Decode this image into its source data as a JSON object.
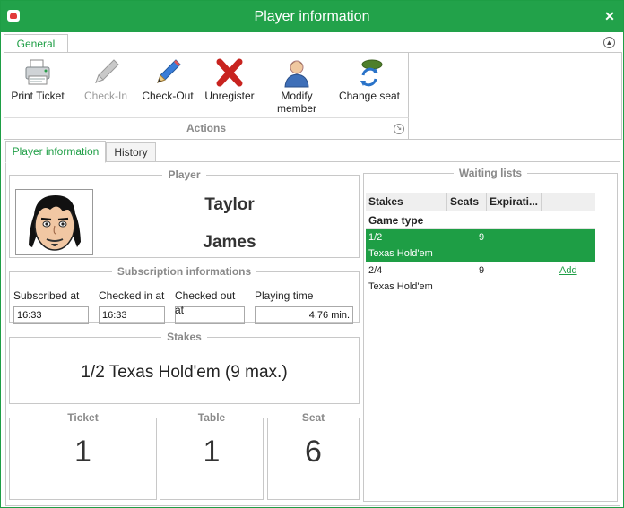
{
  "window": {
    "title": "Player information"
  },
  "ribbon": {
    "tab": "General",
    "buttons": [
      {
        "label": "Print Ticket",
        "icon": "printer-icon",
        "enabled": true
      },
      {
        "label": "Check-In",
        "icon": "pencil-icon",
        "enabled": false
      },
      {
        "label": "Check-Out",
        "icon": "pencil-icon",
        "enabled": true
      },
      {
        "label": "Unregister",
        "icon": "red-x-icon",
        "enabled": true
      },
      {
        "label": "Modify member",
        "icon": "user-icon",
        "enabled": true
      },
      {
        "label": "Change seat",
        "icon": "swap-seat-icon",
        "enabled": true
      }
    ],
    "group_label": "Actions"
  },
  "tabs": {
    "player_info": "Player information",
    "history": "History"
  },
  "player": {
    "legend": "Player",
    "first_name": "Taylor",
    "last_name": "James"
  },
  "subscription": {
    "legend": "Subscription informations",
    "subscribed_at_label": "Subscribed at",
    "subscribed_at": "16:33",
    "checked_in_label": "Checked in at",
    "checked_in": "16:33",
    "checked_out_label": "Checked out at",
    "checked_out": "",
    "playing_time_label": "Playing time",
    "playing_time": "4,76 min."
  },
  "stakes": {
    "legend": "Stakes",
    "value": "1/2 Texas Hold'em (9 max.)"
  },
  "ticket": {
    "legend": "Ticket",
    "value": "1"
  },
  "table": {
    "legend": "Table",
    "value": "1"
  },
  "seat": {
    "legend": "Seat",
    "value": "6"
  },
  "waiting": {
    "legend": "Waiting lists",
    "columns": [
      "Stakes",
      "Seats",
      "Expirati..."
    ],
    "group": "Game type",
    "rows": [
      {
        "stakes": "1/2",
        "game": "Texas Hold'em",
        "seats": "9",
        "action": ""
      },
      {
        "stakes": "2/4",
        "game": "Texas Hold'em",
        "seats": "9",
        "action": "Add"
      }
    ]
  },
  "colors": {
    "accent": "#22a24a",
    "selected_row": "#1e9e45"
  }
}
